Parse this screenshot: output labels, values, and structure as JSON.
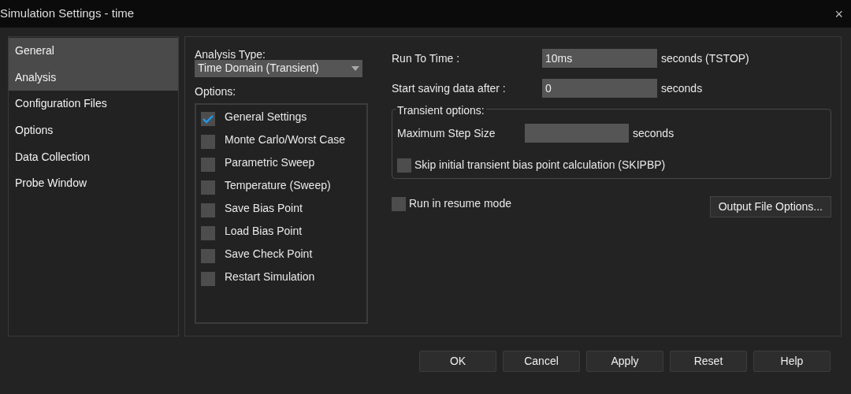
{
  "window": {
    "title": "Simulation Settings - time",
    "close": "×"
  },
  "sidebar": {
    "items": [
      {
        "label": "General",
        "selected": true
      },
      {
        "label": "Analysis",
        "selected": true
      },
      {
        "label": "Configuration Files",
        "selected": false
      },
      {
        "label": "Options",
        "selected": false
      },
      {
        "label": "Data Collection",
        "selected": false
      },
      {
        "label": "Probe Window",
        "selected": false
      }
    ]
  },
  "analysis_type": {
    "label": "Analysis Type:",
    "value": "Time Domain (Transient)"
  },
  "options": {
    "label": "Options:",
    "items": [
      {
        "label": "General Settings",
        "checked": true
      },
      {
        "label": "Monte Carlo/Worst Case",
        "checked": false
      },
      {
        "label": "Parametric Sweep",
        "checked": false
      },
      {
        "label": "Temperature (Sweep)",
        "checked": false
      },
      {
        "label": "Save Bias Point",
        "checked": false
      },
      {
        "label": "Load Bias Point",
        "checked": false
      },
      {
        "label": "Save Check Point",
        "checked": false
      },
      {
        "label": "Restart Simulation",
        "checked": false
      }
    ]
  },
  "run_to_time": {
    "label": "Run To Time :",
    "value": "10ms",
    "unit": "seconds (TSTOP)"
  },
  "start_saving": {
    "label": "Start saving data after :",
    "value": "0",
    "unit": "seconds"
  },
  "transient_options": {
    "title": "Transient options:",
    "max_step": {
      "label": "Maximum Step Size",
      "unit": "seconds"
    },
    "skip_bias": {
      "label": "Skip initial transient bias point calculation (SKIPBP)",
      "checked": false
    }
  },
  "resume_mode": {
    "label": "Run in resume mode",
    "checked": false
  },
  "output_file_options": "Output File Options...",
  "buttons": [
    "OK",
    "Cancel",
    "Apply",
    "Reset",
    "Help"
  ]
}
